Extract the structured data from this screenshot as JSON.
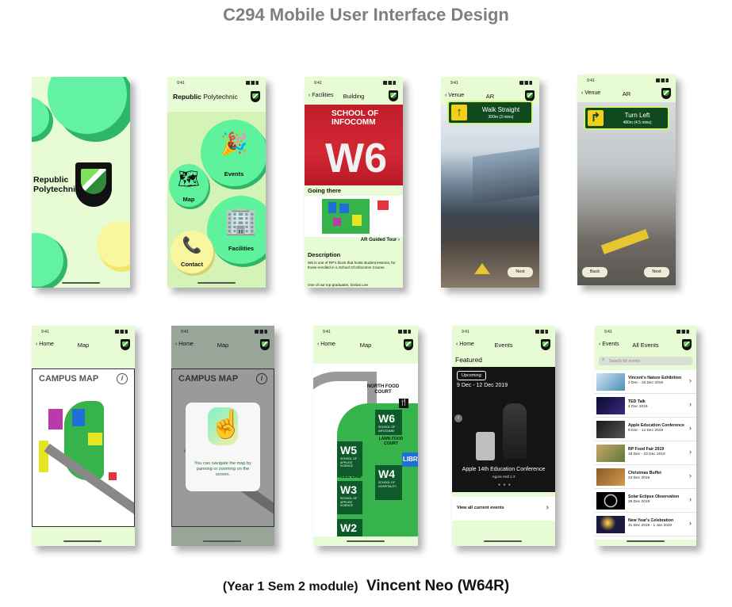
{
  "page": {
    "title": "C294 Mobile User Interface Design",
    "footer_subtitle": "(Year 1 Sem 2 module)",
    "footer_author": "Vincent Neo (W64R)"
  },
  "colors": {
    "screen_bg": "#e7fbd5",
    "accent_green": "#5ef29c",
    "dark_green": "#0d5a2a",
    "yellow": "#f8f7a0"
  },
  "splash": {
    "logo_line1": "Republic",
    "logo_line2": "Polytechnic"
  },
  "menu": {
    "time": "9:41",
    "header_bold": "Republic",
    "header_rest": " Polytechnic",
    "items": [
      {
        "label": "Events",
        "icon": "party-popper-icon"
      },
      {
        "label": "Map",
        "icon": "map-icon"
      },
      {
        "label": "Facilities",
        "icon": "buildings-icon"
      },
      {
        "label": "Contact",
        "icon": "phone-icon"
      }
    ]
  },
  "building": {
    "time": "9:41",
    "back": "Facilities",
    "title": "Building",
    "sign_line1": "SCHOOL OF",
    "sign_line2": "INFOCOMM",
    "sign_big": "W6",
    "going_there": "Going there",
    "ar_tour": "AR Guided Tour",
    "description_heading": "Description",
    "description_p1": "W6 is one of RP's block that hosts student lessons, for those enrolled in a School Of Infocomm Course.",
    "description_p2": "One of our top graduates, Dorian Lee"
  },
  "ar1": {
    "time": "9:41",
    "back": "Venue",
    "title": "AR",
    "instruction": "Walk Straight",
    "distance": "300m (3 mins)",
    "next": "Next"
  },
  "ar2": {
    "time": "9:41",
    "back": "Venue",
    "title": "AR",
    "instruction": "Turn Left",
    "distance": "480m (4.5 mins)",
    "back_btn": "Back",
    "next": "Next"
  },
  "map1": {
    "time": "9:41",
    "back": "Home",
    "title": "Map",
    "campus_title": "CAMPUS MAP",
    "info": "i"
  },
  "map2": {
    "time": "9:41",
    "back": "Home",
    "title": "Map",
    "campus_title": "CAMPUS MAP",
    "info": "i",
    "hint": "You can navigate the map by panning or zooming on the screen."
  },
  "map3": {
    "time": "9:41",
    "back": "Home",
    "title": "Map",
    "food_court": "NORTH FOOD COURT",
    "lawn": "LAWN FOOD COURT",
    "acel": "ACEL LAB",
    "libr": "LIBR",
    "blocks": [
      {
        "code": "W6",
        "desc": "SCHOOL OF INFOCOMM"
      },
      {
        "code": "W5",
        "desc": "SCHOOL OF APPLIED SCIENCE"
      },
      {
        "code": "W4",
        "desc": "SCHOOL OF HOSPITALITY"
      },
      {
        "code": "W3",
        "desc": "SCHOOL OF APPLIED SCIENCE"
      },
      {
        "code": "W2",
        "desc": ""
      }
    ]
  },
  "events": {
    "time": "9:41",
    "back": "Home",
    "title": "Events",
    "featured": "Featured",
    "badge": "Upcoming",
    "dates": "9 Dec - 12 Dec 2019",
    "caption": "Apple 14th Education Conference",
    "caption_sub": "Agora Hall 1-3",
    "view_all": "View all current events"
  },
  "all_events": {
    "time": "9:41",
    "back": "Events",
    "title": "All Events",
    "search_placeholder": "Search for events",
    "items": [
      {
        "title": "Vincent's Nature Exhibition",
        "date": "2 Dec - 16 Dec 2019"
      },
      {
        "title": "TED Talk",
        "date": "4 Dec 2019"
      },
      {
        "title": "Apple Education Conference",
        "date": "9 Dec - 12 Dec 2019"
      },
      {
        "title": "RP Food Fair 2019",
        "date": "18 Dec - 23 Dec 2019"
      },
      {
        "title": "Christmas Buffet",
        "date": "24 Dec 2019"
      },
      {
        "title": "Solar Eclipse Observation",
        "date": "26 Dec 2019"
      },
      {
        "title": "New Year's Celebration",
        "date": "31 Dec 2019 - 1 Jan 2020"
      }
    ]
  }
}
